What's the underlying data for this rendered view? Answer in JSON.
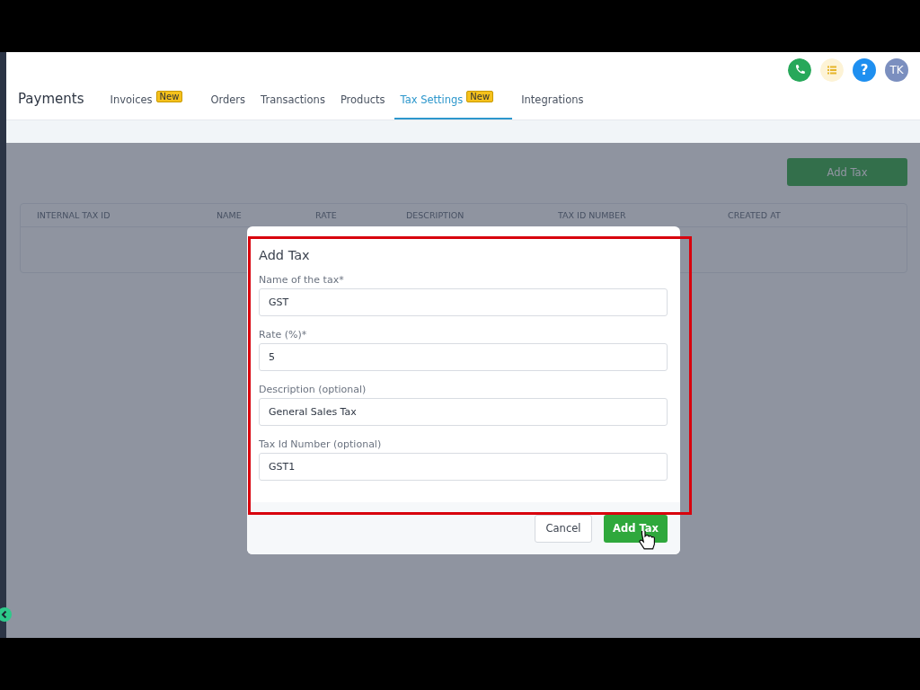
{
  "header": {
    "title": "Payments",
    "tabs": [
      {
        "label": "Invoices",
        "selected": false,
        "badge": "New"
      },
      {
        "label": "Orders",
        "selected": false
      },
      {
        "label": "Transactions",
        "selected": false
      },
      {
        "label": "Products",
        "selected": false
      },
      {
        "label": "Tax Settings",
        "selected": true,
        "badge": "New"
      },
      {
        "label": "Integrations",
        "selected": false
      }
    ],
    "help_glyph": "?",
    "avatar": "TK"
  },
  "toolbar": {
    "button": "Add Tax"
  },
  "table": {
    "columns": [
      "INTERNAL TAX ID",
      "NAME",
      "RATE",
      "DESCRIPTION",
      "TAX ID NUMBER",
      "CREATED AT"
    ]
  },
  "dialog": {
    "title": "Add Tax",
    "fields": [
      {
        "label": "Name of the tax*",
        "value": "GST"
      },
      {
        "label": "Rate (%)*",
        "value": "5"
      },
      {
        "label": "Description (optional)",
        "value": "General Sales Tax"
      },
      {
        "label": "Tax Id Number (optional)",
        "value": "GST1"
      }
    ],
    "buttons": [
      {
        "label": "Cancel",
        "kind": "secondary"
      },
      {
        "label": "Add Tax",
        "kind": "primary"
      }
    ]
  }
}
